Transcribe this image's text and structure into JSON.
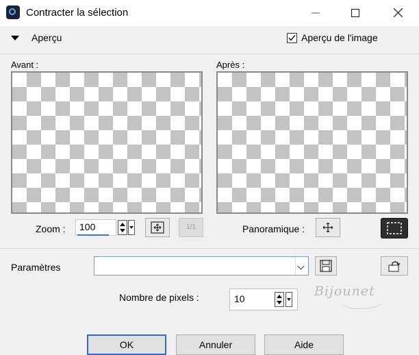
{
  "window": {
    "title": "Contracter la sélection",
    "minimize_icon": "minimize-icon",
    "maximize_icon": "maximize-icon",
    "close_icon": "close-icon"
  },
  "preview_section": {
    "title": "Aperçu",
    "expand_icon": "triangle-down-icon",
    "checkbox_label": "Aperçu de l'image",
    "checkbox_checked": true
  },
  "before": {
    "label": "Avant :"
  },
  "after": {
    "label": "Après :"
  },
  "zoom": {
    "label": "Zoom :",
    "value": "100",
    "fit_icon": "fit-to-window-icon",
    "actual_size_label": "1/1"
  },
  "pan": {
    "label": "Panoramique :",
    "move_icon": "move-arrows-icon",
    "select_icon": "selection-marquee-icon"
  },
  "params": {
    "label": "Paramètres",
    "preset_value": "",
    "save_icon": "save-disk-icon",
    "reset_icon": "reset-preset-icon"
  },
  "pixels": {
    "label": "Nombre de pixels :",
    "value": "10"
  },
  "watermark": {
    "text": "Bijounet"
  },
  "buttons": {
    "ok": "OK",
    "cancel": "Annuler",
    "help": "Aide"
  },
  "colors": {
    "accent": "#2a6fc4",
    "checker": "#c3c3c3"
  }
}
